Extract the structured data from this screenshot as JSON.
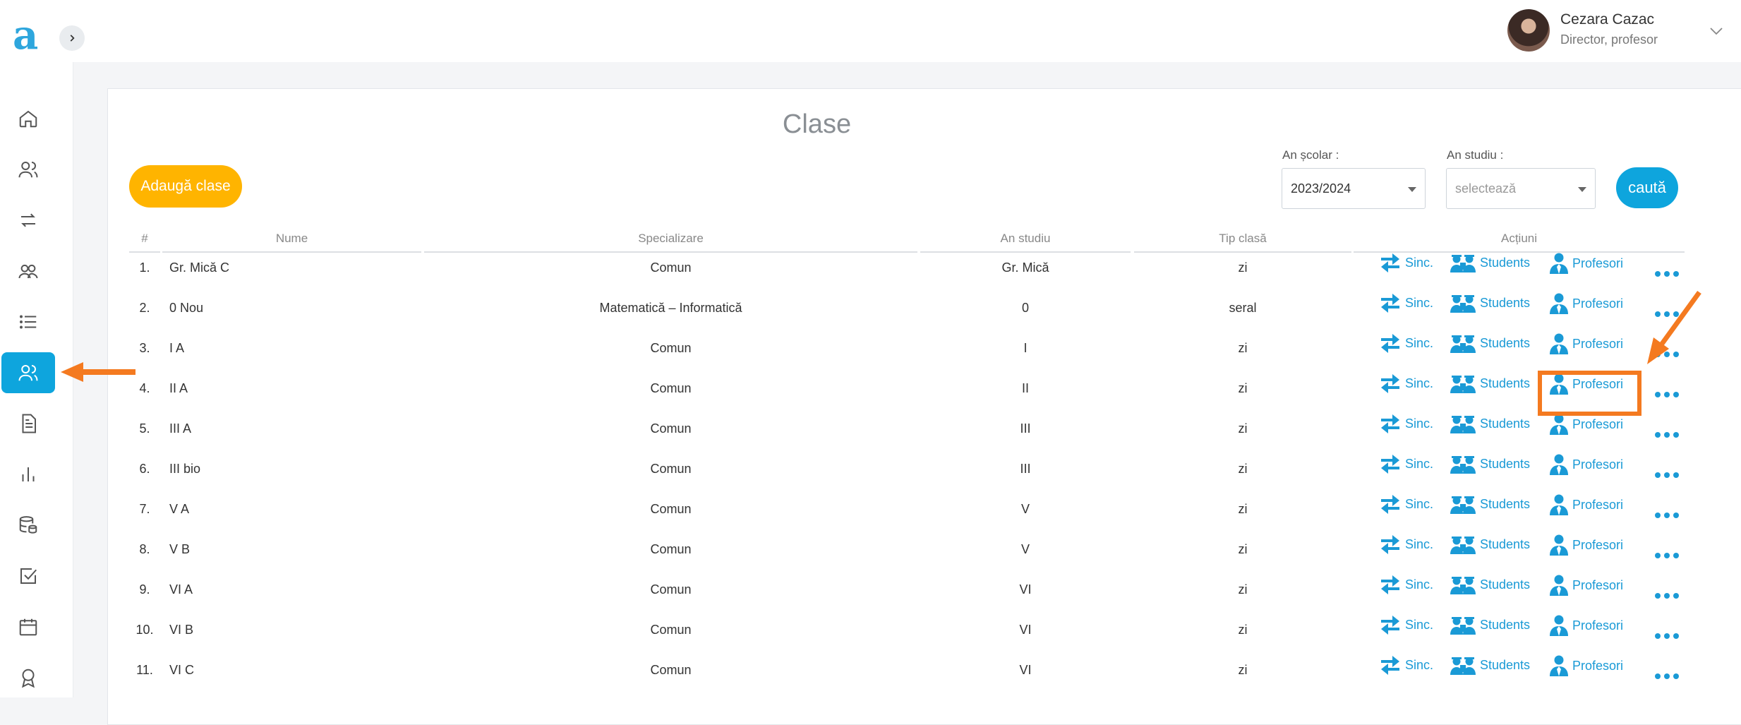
{
  "app": {
    "logo_letter": "a"
  },
  "user": {
    "name": "Cezara Cazac",
    "role": "Director, profesor"
  },
  "sidebar": {
    "items": [
      {
        "name": "home-icon"
      },
      {
        "name": "users-icon"
      },
      {
        "name": "sync-icon"
      },
      {
        "name": "group-icon"
      },
      {
        "name": "list-icon"
      },
      {
        "name": "classes-icon",
        "active": true
      },
      {
        "name": "document-icon"
      },
      {
        "name": "chart-icon"
      },
      {
        "name": "database-icon"
      },
      {
        "name": "checkbox-icon"
      },
      {
        "name": "calendar-icon"
      },
      {
        "name": "award-icon"
      }
    ]
  },
  "page": {
    "title": "Clase",
    "add_button": "Adaugă clase",
    "search_button": "caută"
  },
  "filters": {
    "school_year_label": "An școlar :",
    "school_year_value": "2023/2024",
    "study_year_label": "An studiu :",
    "study_year_placeholder": "selectează"
  },
  "table": {
    "headers": {
      "index": "#",
      "name": "Nume",
      "specialization": "Specializare",
      "study_year": "An studiu",
      "class_type": "Tip clasă",
      "actions": "Acțiuni"
    },
    "actions": {
      "sync": "Sinc.",
      "students": "Students",
      "teachers": "Profesori"
    },
    "rows": [
      {
        "index": "1.",
        "name": "Gr. Mică C",
        "specialization": "Comun",
        "study_year": "Gr. Mică",
        "class_type": "zi"
      },
      {
        "index": "2.",
        "name": "0 Nou",
        "specialization": "Matematică – Informatică",
        "study_year": "0",
        "class_type": "seral"
      },
      {
        "index": "3.",
        "name": "I A",
        "specialization": "Comun",
        "study_year": "I",
        "class_type": "zi"
      },
      {
        "index": "4.",
        "name": "II A",
        "specialization": "Comun",
        "study_year": "II",
        "class_type": "zi"
      },
      {
        "index": "5.",
        "name": "III A",
        "specialization": "Comun",
        "study_year": "III",
        "class_type": "zi"
      },
      {
        "index": "6.",
        "name": "III bio",
        "specialization": "Comun",
        "study_year": "III",
        "class_type": "zi"
      },
      {
        "index": "7.",
        "name": "V A",
        "specialization": "Comun",
        "study_year": "V",
        "class_type": "zi"
      },
      {
        "index": "8.",
        "name": "V B",
        "specialization": "Comun",
        "study_year": "V",
        "class_type": "zi"
      },
      {
        "index": "9.",
        "name": "VI A",
        "specialization": "Comun",
        "study_year": "VI",
        "class_type": "zi"
      },
      {
        "index": "10.",
        "name": "VI B",
        "specialization": "Comun",
        "study_year": "VI",
        "class_type": "zi"
      },
      {
        "index": "11.",
        "name": "VI C",
        "specialization": "Comun",
        "study_year": "VI",
        "class_type": "zi"
      }
    ]
  },
  "colors": {
    "accent": "#0ea5dd",
    "add_button": "#ffb400",
    "annotation": "#f47a20"
  }
}
